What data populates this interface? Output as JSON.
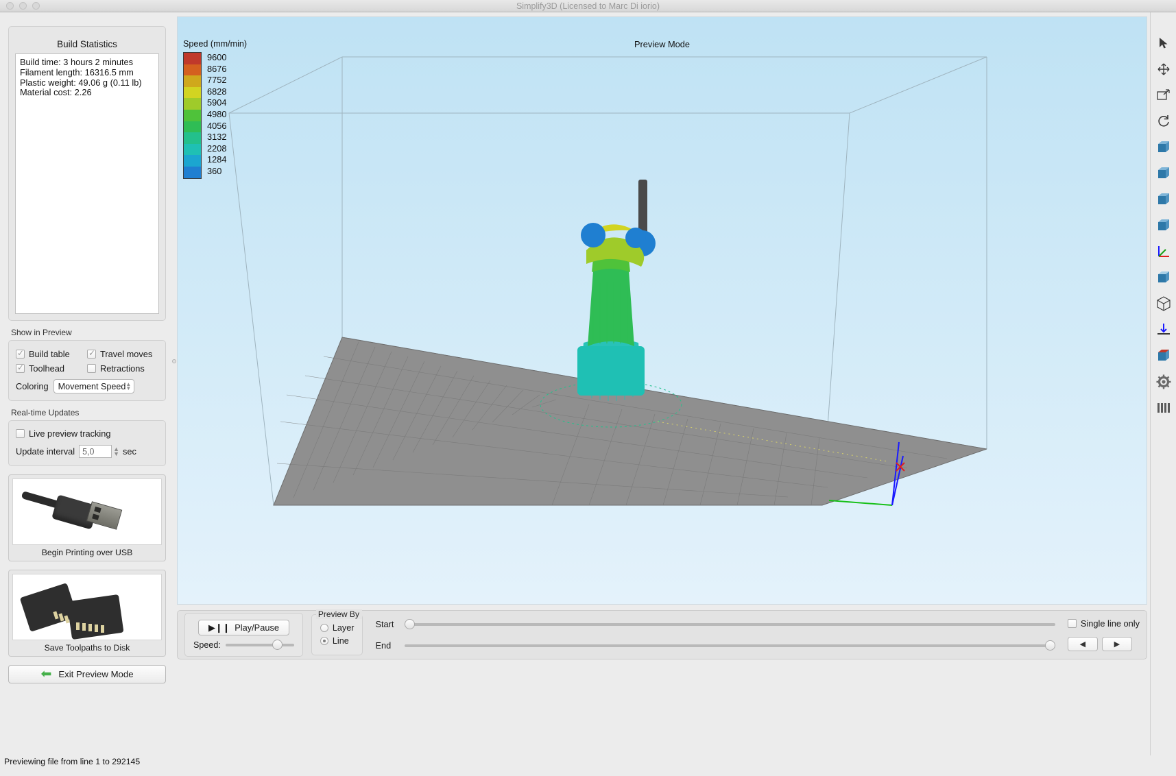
{
  "window": {
    "title": "Simplify3D (Licensed to Marc Di iorio)"
  },
  "left_panel": {
    "stats_title": "Build Statistics",
    "stats_lines": [
      "Build time: 3 hours 2 minutes",
      "Filament length: 16316.5 mm",
      "Plastic weight: 49.06 g (0.11 lb)",
      "Material cost: 2.26"
    ],
    "show_in_preview_label": "Show in Preview",
    "checkboxes": [
      {
        "label": "Build table",
        "checked": true
      },
      {
        "label": "Travel moves",
        "checked": true
      },
      {
        "label": "Toolhead",
        "checked": true
      },
      {
        "label": "Retractions",
        "checked": false
      }
    ],
    "coloring_label": "Coloring",
    "coloring_value": "Movement Speed",
    "realtime_label": "Real-time Updates",
    "live_preview_label": "Live preview tracking",
    "live_preview_checked": false,
    "update_interval_label": "Update interval",
    "update_interval_value": "5,0",
    "update_interval_unit": "sec",
    "usb_button_label": "Begin Printing over USB",
    "sd_button_label": "Save Toolpaths to Disk",
    "exit_button_label": "Exit Preview Mode"
  },
  "viewport": {
    "mode_title": "Preview Mode",
    "legend_title": "Speed (mm/min)"
  },
  "chart_data": {
    "type": "heatmap",
    "title": "Speed (mm/min)",
    "ylabel": "Speed (mm/min)",
    "legend_position": "top-left",
    "grid": false,
    "categories": [
      "9600",
      "8676",
      "7752",
      "6828",
      "5904",
      "4980",
      "4056",
      "3132",
      "2208",
      "1284",
      "360"
    ],
    "values": [
      9600,
      8676,
      7752,
      6828,
      5904,
      4980,
      4056,
      3132,
      2208,
      1284,
      360
    ],
    "colors": [
      "#c0392b",
      "#d4601f",
      "#cfa81c",
      "#d2d421",
      "#9fcb2a",
      "#4fc23a",
      "#2fbd55",
      "#23c08c",
      "#1fc0b4",
      "#1ba6d0",
      "#1f7fd1"
    ],
    "ylim": [
      360,
      9600
    ]
  },
  "controls": {
    "play_pause_label": "Play/Pause",
    "speed_label": "Speed:",
    "preview_by_label": "Preview By",
    "preview_by_options": [
      {
        "label": "Layer",
        "selected": false
      },
      {
        "label": "Line",
        "selected": true
      }
    ],
    "start_label": "Start",
    "end_label": "End",
    "single_line_label": "Single line only",
    "single_line_checked": false,
    "prev_arrow": "◀",
    "next_arrow": "▶",
    "play_glyph": "▶❙❙",
    "start_value_pct": 0,
    "end_value_pct": 100,
    "speed_value_pct": 72
  },
  "toolbar": {
    "items": [
      {
        "name": "select-arrow-icon"
      },
      {
        "name": "move-icon"
      },
      {
        "name": "scale-icon"
      },
      {
        "name": "rotate-icon"
      },
      {
        "name": "view-front-icon"
      },
      {
        "name": "view-back-icon"
      },
      {
        "name": "view-left-icon"
      },
      {
        "name": "view-right-icon"
      },
      {
        "name": "axes-icon"
      },
      {
        "name": "view-top-icon"
      },
      {
        "name": "view-iso-icon"
      },
      {
        "name": "view-bottom-icon"
      },
      {
        "name": "cross-section-icon"
      },
      {
        "name": "settings-gear-icon"
      },
      {
        "name": "layers-icon"
      }
    ]
  },
  "status_bar": {
    "text": "Previewing file from line 1 to 292145"
  }
}
